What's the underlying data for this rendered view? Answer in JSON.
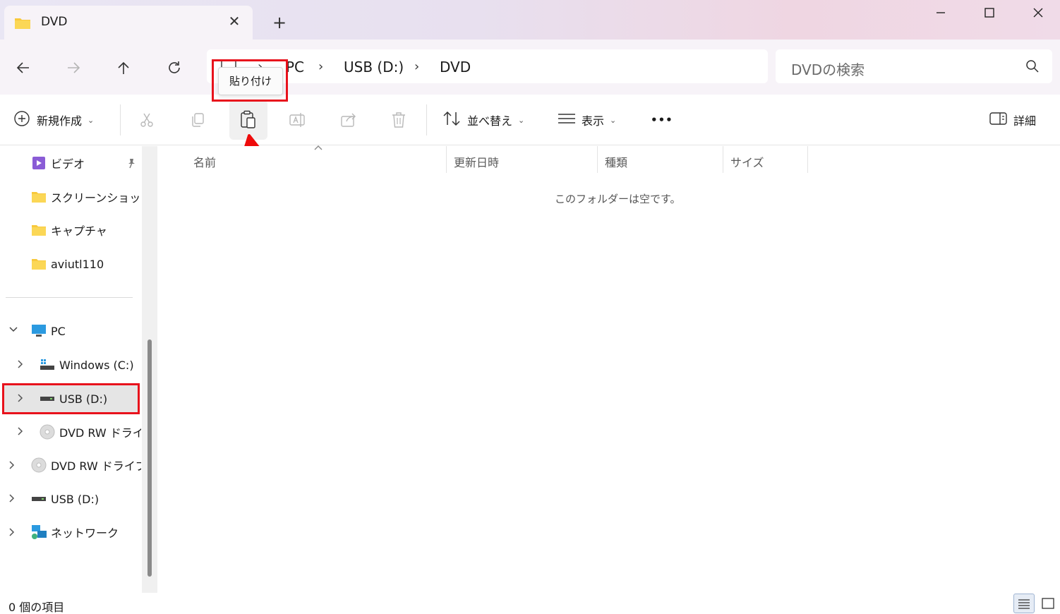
{
  "window": {
    "tab_title": "DVD",
    "tab_close_glyph": "✕",
    "new_tab_glyph": "+",
    "controls": [
      "minimize-icon",
      "maximize-icon",
      "close-icon"
    ]
  },
  "address_bar": {
    "crumbs": [
      "PC",
      "USB (D:)",
      "DVD"
    ],
    "separator": "›"
  },
  "search": {
    "placeholder": "DVDの検索"
  },
  "toolbar": {
    "new_label": "新規作成",
    "sort_label": "並べ替え",
    "view_label": "表示",
    "more_glyph": "•••",
    "details_label": "詳細",
    "paste_tooltip": "貼り付け"
  },
  "sidebar": {
    "quick_access": [
      {
        "label": "ビデオ",
        "icon": "video-folder-icon",
        "pinned": true
      },
      {
        "label": "スクリーンショット",
        "icon": "folder-icon"
      },
      {
        "label": "キャプチャ",
        "icon": "folder-icon"
      },
      {
        "label": "aviutl110",
        "icon": "folder-icon"
      }
    ],
    "pc_label": "PC",
    "pc_children": [
      {
        "label": "Windows (C:)",
        "icon": "windows-drive-icon"
      },
      {
        "label": "USB (D:)",
        "icon": "usb-drive-icon",
        "selected": true
      },
      {
        "label": "DVD RW ドライ",
        "icon": "dvd-drive-icon"
      }
    ],
    "root_items": [
      {
        "label": "DVD RW ドライブ",
        "icon": "dvd-drive-icon"
      },
      {
        "label": "USB (D:)",
        "icon": "usb-drive-icon"
      },
      {
        "label": "ネットワーク",
        "icon": "network-icon"
      }
    ]
  },
  "content": {
    "columns": [
      "名前",
      "更新日時",
      "種類",
      "サイズ"
    ],
    "empty_message": "このフォルダーは空です。"
  },
  "status": {
    "item_count": "0 個の項目"
  },
  "colors": {
    "highlight_red": "#e8121c",
    "folder_yellow": "#f8c93c",
    "selected_bg": "#e5e5e5"
  }
}
